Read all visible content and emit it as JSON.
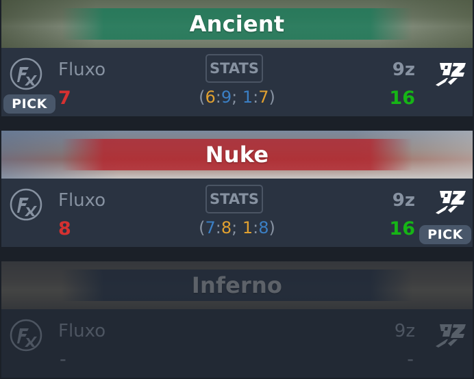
{
  "maps": [
    {
      "name": "Ancient",
      "band_color": "#1f7a5a",
      "team1": {
        "name": "Fluxo",
        "score": "7",
        "score_color": "#d53131"
      },
      "team2": {
        "name": "9z",
        "score": "16",
        "score_color": "#16b516"
      },
      "stats_label": "STATS",
      "halves": [
        {
          "t1": "6",
          "t2": "9",
          "t1_color": "#e0a030",
          "t2_color": "#3b7fc4"
        },
        {
          "t1": "1",
          "t2": "7",
          "t1_color": "#3b7fc4",
          "t2_color": "#e0a030"
        }
      ],
      "pick_label": "PICK",
      "pick_side": "team1"
    },
    {
      "name": "Nuke",
      "band_color": "#b3262f",
      "team1": {
        "name": "Fluxo",
        "score": "8",
        "score_color": "#d53131"
      },
      "team2": {
        "name": "9z",
        "score": "16",
        "score_color": "#16b516"
      },
      "stats_label": "STATS",
      "halves": [
        {
          "t1": "7",
          "t2": "8",
          "t1_color": "#3b7fc4",
          "t2_color": "#e0a030"
        },
        {
          "t1": "1",
          "t2": "8",
          "t1_color": "#e0a030",
          "t2_color": "#3b7fc4"
        }
      ],
      "pick_label": "PICK",
      "pick_side": "team2"
    },
    {
      "name": "Inferno",
      "band_color": "#2b3f5c",
      "team1": {
        "name": "Fluxo",
        "score": "-"
      },
      "team2": {
        "name": "9z",
        "score": "-"
      }
    }
  ]
}
